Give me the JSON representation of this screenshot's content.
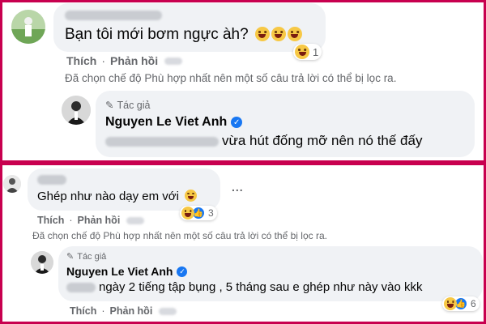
{
  "comment1": {
    "text": "Bạn tôi mới bơm ngực àh?",
    "emoji_icons": [
      "laugh-icon",
      "laugh-icon",
      "laugh-icon"
    ],
    "reaction_count": "1",
    "like_label": "Thích",
    "reply_label": "Phản hồi"
  },
  "filter_note_1": "Đã chọn chế độ Phù hợp nhất nên một số câu trả lời có thể bị lọc ra.",
  "reply1": {
    "author_tag": "Tác giả",
    "author_name": "Nguyen Le Viet Anh",
    "text": "vừa hút đống mỡ nên nó thế đấy"
  },
  "comment2": {
    "text": "Ghép như nào dạy em với",
    "emoji_icon": "laugh-icon",
    "more_label": "...",
    "reaction_count": "3",
    "like_label": "Thích",
    "reply_label": "Phản hồi"
  },
  "filter_note_2": "Đã chọn chế độ Phù hợp nhất nên một số câu trả lời có thể bị lọc ra.",
  "reply2": {
    "author_tag": "Tác giả",
    "author_name": "Nguyen Le Viet Anh",
    "text": "ngày 2 tiếng tập bụng , 5 tháng sau e ghép như này vào kkk",
    "reaction_count": "6",
    "like_label": "Thích",
    "reply_label": "Phản hồi"
  },
  "colors": {
    "frame": "#c8004f",
    "bubble": "#f0f2f5",
    "secondary_text": "#65676b",
    "verified": "#1877f2",
    "emoji": "#f7c845"
  }
}
